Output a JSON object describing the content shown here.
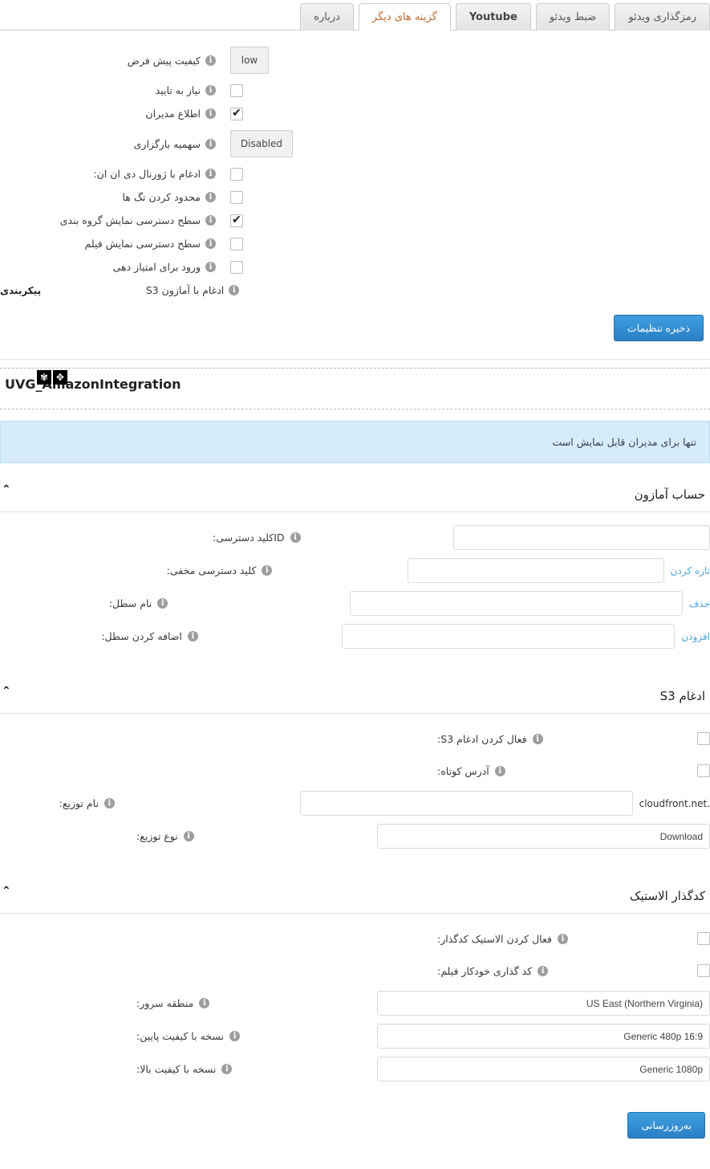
{
  "tabs": [
    {
      "label": "رمزگذاری ویدئو",
      "active": false,
      "latin": false
    },
    {
      "label": "ضبط ویدئو",
      "active": false,
      "latin": false
    },
    {
      "label": "Youtube",
      "active": false,
      "latin": true
    },
    {
      "label": "گزینه های دیگر",
      "active": true,
      "latin": false
    },
    {
      "label": "درباره",
      "active": false,
      "latin": false
    }
  ],
  "other_options": {
    "rows": [
      {
        "label": "کیفیت پیش فرض",
        "type": "select",
        "value": "low",
        "wide": false,
        "extra": ""
      },
      {
        "label": "نیاز به تایید",
        "type": "checkbox",
        "checked": false,
        "extra": ""
      },
      {
        "label": "اطلاع مدیران",
        "type": "checkbox",
        "checked": true,
        "extra": ""
      },
      {
        "label": "سهمیه بارگزاری",
        "type": "select",
        "value": "Disabled",
        "wide": true,
        "extra": ""
      },
      {
        "label": "ادغام با ژورنال دی ان ان:",
        "type": "checkbox",
        "checked": false,
        "extra": ""
      },
      {
        "label": "محدود کردن تگ ها",
        "type": "checkbox",
        "checked": false,
        "extra": ""
      },
      {
        "label": "سطح دسترسی نمایش گروه بندی",
        "type": "checkbox",
        "checked": true,
        "extra": ""
      },
      {
        "label": "سطح دسترسی نمایش فیلم",
        "type": "checkbox",
        "checked": false,
        "extra": ""
      },
      {
        "label": "ورود برای امتیاز دهی",
        "type": "checkbox",
        "checked": false,
        "extra": ""
      },
      {
        "label": "ادغام با آمازون S3",
        "type": "link",
        "checked": false,
        "extra": "پیکربندی"
      }
    ],
    "save_label": "ذخیره تنظیمات"
  },
  "plugin": {
    "title": "UVG_AmazonIntegration",
    "move_icon": "✥",
    "gear_icon": "✾"
  },
  "notice": {
    "text": "تنها برای مدیران قابل نمایش است"
  },
  "sections": [
    {
      "title": "حساب آمازون",
      "chevron": "︿",
      "fields": [
        {
          "label": "IDکلید دسترسی:",
          "type": "text",
          "value": "",
          "width": "w320",
          "link": "",
          "suffix": ""
        },
        {
          "label": "کلید دسترسی مخفی:",
          "type": "text",
          "value": "",
          "width": "w320",
          "link": "تازه کردن",
          "suffix": ""
        },
        {
          "label": "نام سطل:",
          "type": "text",
          "value": "",
          "width": "w415",
          "link": "حذف",
          "suffix": ""
        },
        {
          "label": "اضافه کردن سطل:",
          "type": "text",
          "value": "",
          "width": "w415",
          "link": "افزودن",
          "suffix": ""
        }
      ]
    },
    {
      "title": "ادغام S3",
      "chevron": "︿",
      "fields": [
        {
          "label": "فعال کردن ادغام S3:",
          "type": "checkbox",
          "checked": false,
          "value": "",
          "width": "",
          "link": "",
          "suffix": ""
        },
        {
          "label": "آدرس کوتاه:",
          "type": "checkbox",
          "checked": false,
          "value": "",
          "width": "",
          "link": "",
          "suffix": ""
        },
        {
          "label": "نام توزیع:",
          "type": "text",
          "value": "",
          "width": "w415",
          "link": "",
          "suffix": "cloudfront.net."
        },
        {
          "label": "نوع توزیع:",
          "type": "text",
          "value": "Download",
          "width": "w415",
          "link": "",
          "suffix": ""
        }
      ]
    },
    {
      "title": "کدگذار الاستیک",
      "chevron": "︿",
      "fields": [
        {
          "label": "فعال کردن الاستیک کدگذار:",
          "type": "checkbox",
          "checked": false,
          "value": "",
          "width": "",
          "link": "",
          "suffix": ""
        },
        {
          "label": "کد گذاری خودکار فیلم:",
          "type": "checkbox",
          "checked": false,
          "value": "",
          "width": "",
          "link": "",
          "suffix": ""
        },
        {
          "label": "منطقه سرور:",
          "type": "text",
          "value": "US East (Northern Virginia)",
          "width": "w415",
          "link": "",
          "suffix": ""
        },
        {
          "label": "نسخه با کیفیت پایین:",
          "type": "text",
          "value": "Generic 480p 16:9",
          "width": "w415",
          "link": "",
          "suffix": ""
        },
        {
          "label": "نسخه با کیفیت بالا:",
          "type": "text",
          "value": "Generic 1080p",
          "width": "w415",
          "link": "",
          "suffix": ""
        }
      ]
    }
  ],
  "update_button": {
    "label": "به‌روزرسانی"
  },
  "colors": {
    "accent": "#2a7fc4",
    "link": "#4aa3d8",
    "notice_bg": "#d7ecfb",
    "active_tab_text": "#c06b33"
  }
}
